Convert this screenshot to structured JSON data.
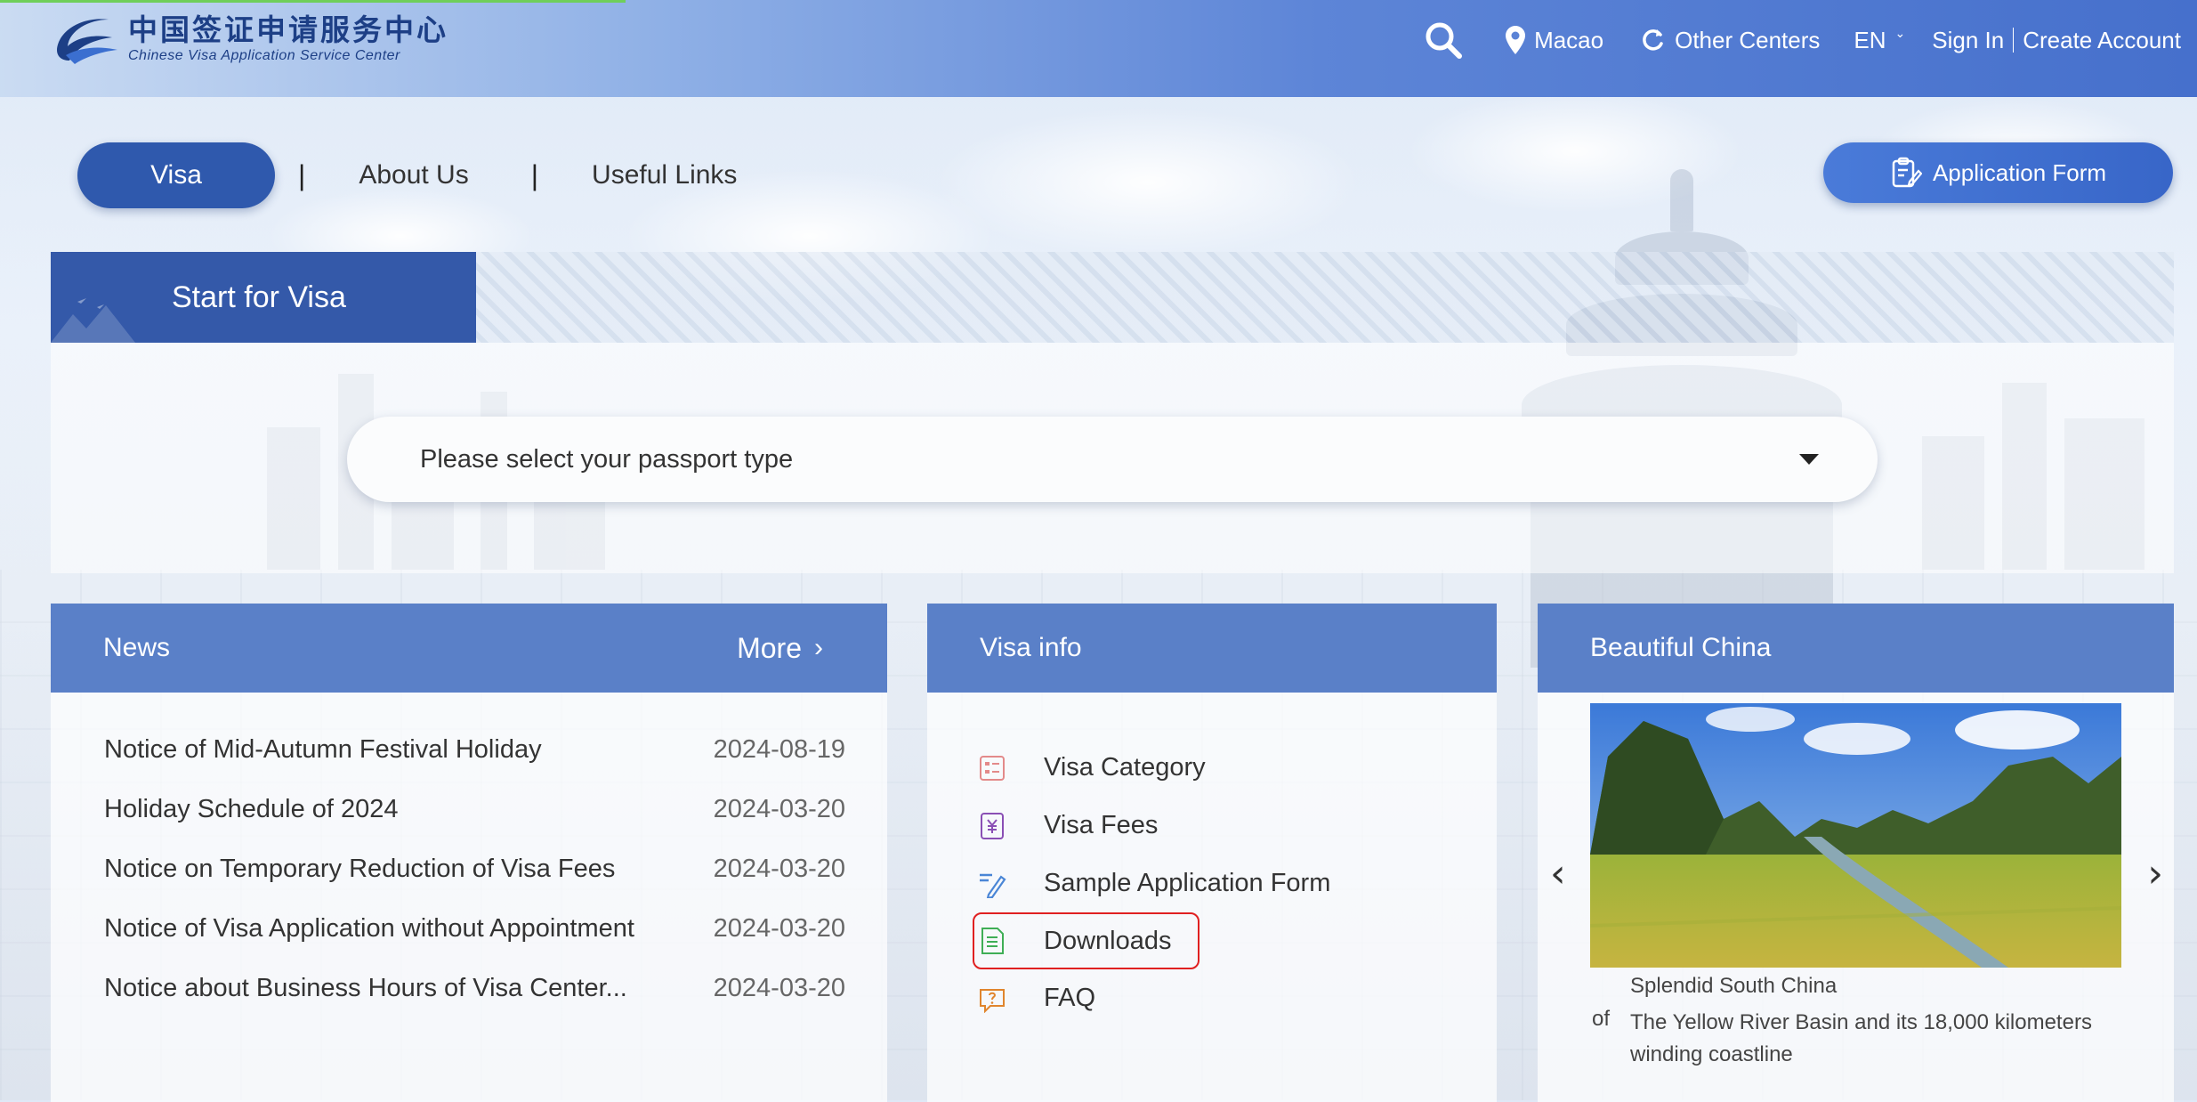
{
  "header": {
    "logo_cn": "中国签证申请服务中心",
    "logo_en": "Chinese Visa Application Service Center",
    "location": "Macao",
    "other_centers": "Other Centers",
    "language": "EN",
    "sign_in": "Sign In",
    "create_account": "Create Account"
  },
  "nav": {
    "visa": "Visa",
    "about_us": "About Us",
    "useful_links": "Useful Links",
    "application_form": "Application Form",
    "separator": "|"
  },
  "start": {
    "title": "Start for Visa",
    "passport_placeholder": "Please select your passport type"
  },
  "news": {
    "title": "News",
    "more": "More",
    "items": [
      {
        "title": "Notice of Mid-Autumn Festival Holiday",
        "date": "2024-08-19"
      },
      {
        "title": "Holiday Schedule of 2024",
        "date": "2024-03-20"
      },
      {
        "title": "Notice on Temporary Reduction of Visa Fees",
        "date": "2024-03-20"
      },
      {
        "title": "Notice of Visa Application without Appointment",
        "date": "2024-03-20"
      },
      {
        "title": "Notice about Business Hours of Visa Center...",
        "date": "2024-03-20"
      }
    ]
  },
  "visa_info": {
    "title": "Visa info",
    "items": [
      {
        "label": "Visa Category",
        "icon": "list-icon"
      },
      {
        "label": "Visa Fees",
        "icon": "yen-icon"
      },
      {
        "label": "Sample Application Form",
        "icon": "pen-icon"
      },
      {
        "label": "Downloads",
        "icon": "document-icon"
      },
      {
        "label": "FAQ",
        "icon": "chat-question-icon"
      }
    ]
  },
  "beautiful_china": {
    "title": "Beautiful China",
    "caption_title": "Splendid South China",
    "caption_prefix": "of",
    "caption_desc": "The Yellow River Basin and its 18,000 kilometers winding coastline"
  },
  "colors": {
    "primary": "#2f59ad",
    "header_panel": "#5a80c8",
    "highlight_outline": "#e02020"
  }
}
